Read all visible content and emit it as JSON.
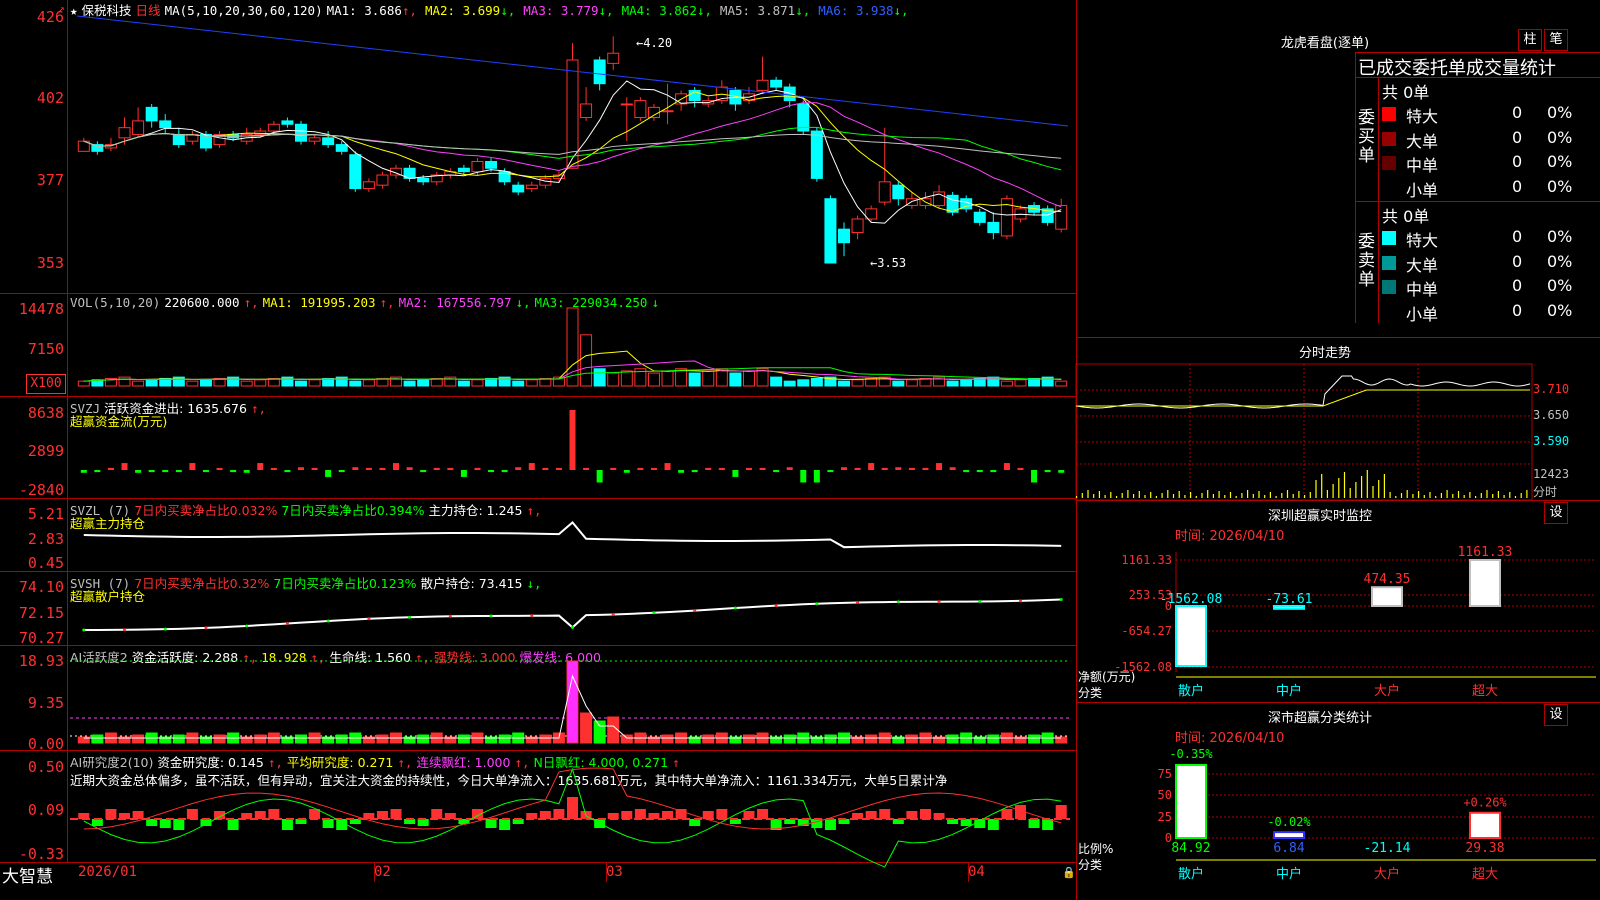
{
  "main_chart": {
    "star": "★",
    "stock_name": "保税科技",
    "period": "日线",
    "ma_label": "MA(5,10,20,30,60,120)",
    "ma_values": [
      {
        "label": "MA1:",
        "value": "3.686",
        "arrow": "↑",
        "color": "#ffffff"
      },
      {
        "label": "MA2:",
        "value": "3.699",
        "arrow": "↓",
        "color": "#ffff00"
      },
      {
        "label": "MA3:",
        "value": "3.779",
        "arrow": "↓",
        "color": "#ff40ff"
      },
      {
        "label": "MA4:",
        "value": "3.862",
        "arrow": "↓",
        "color": "#00ff00"
      },
      {
        "label": "MA5:",
        "value": "3.871",
        "arrow": "↓",
        "color": "#c0c0c0"
      },
      {
        "label": "MA6:",
        "value": "3.938",
        "arrow": "↓",
        "color": "#3060ff"
      }
    ],
    "y_ticks": [
      "426",
      "402",
      "377",
      "353"
    ],
    "high_label": "4.20",
    "low_label": "3.53"
  },
  "vol_panel": {
    "title": "VOL(5,10,20)",
    "value": "220600.000",
    "ma1": "MA1: 191995.203",
    "ma2": "MA2: 167556.797",
    "ma3": "MA3: 229034.250",
    "y_ticks": [
      "14478",
      "7150",
      "X100"
    ]
  },
  "svzj_panel": {
    "title": "SVZJ",
    "line1": "活跃资金进出: 1635.676",
    "line2": "超赢资金流(万元)",
    "y_ticks": [
      "8638",
      "2899",
      "-2840"
    ]
  },
  "svzl_panel": {
    "title": "SVZL (7)",
    "a": "7日内买卖净占比0.032%",
    "b": "7日内买卖净占比0.394%",
    "c": "主力持仓: 1.245",
    "line2": "超赢主力持仓",
    "y_ticks": [
      "5.21",
      "2.83",
      "0.45"
    ]
  },
  "svsh_panel": {
    "title": "SVSH (7)",
    "a": "7日内买卖净占比0.32%",
    "b": "7日内买卖净占比0.123%",
    "c": "散户持仓: 73.415",
    "line2": "超赢散户持仓",
    "y_ticks": [
      "74.10",
      "72.15",
      "70.27"
    ]
  },
  "ai_active_panel": {
    "title": "AI活跃度2",
    "a": "资金活跃度: 2.288",
    "b": "18.928",
    "c": "生命线: 1.560",
    "d": "强势线: 3.000",
    "e": "爆发线: 6.000",
    "y_ticks": [
      "18.93",
      "9.35",
      "0.00"
    ]
  },
  "ai_research_panel": {
    "title": "AI研究度2(10)",
    "a": "资金研究度: 0.145",
    "b": "平均研究度: 0.271",
    "c": "连续飘红: 1.000",
    "d": "N日飘红: 4.000, 0.271",
    "comment": "近期大资金总体偏多，虽不活跃，但有异动，宜关注大资金的持续性，今日大单净流入：1635.681万元，其中特大单净流入：1161.334万元，大单5日累计净",
    "y_ticks": [
      "0.50",
      "0.09",
      "-0.33"
    ]
  },
  "x_axis": {
    "labels": [
      "2026/01",
      "02",
      "03",
      "04"
    ],
    "brand": "大智慧"
  },
  "longhu": {
    "title": "龙虎看盘(逐单)",
    "btn_zhu": "柱",
    "btn_bi": "笔",
    "header": "已成交委托单成交量统计",
    "buy_label": "委买单",
    "sell_label": "委卖单",
    "buy_total": "共 0单",
    "sell_total": "共 0单",
    "buy_rows": [
      {
        "name": "特大",
        "count": "0",
        "pct": "0%",
        "color": "#ff0000"
      },
      {
        "name": "大单",
        "count": "0",
        "pct": "0%",
        "color": "#990000"
      },
      {
        "name": "中单",
        "count": "0",
        "pct": "0%",
        "color": "#660000"
      },
      {
        "name": "小单",
        "count": "0",
        "pct": "0%",
        "color": ""
      }
    ],
    "sell_rows": [
      {
        "name": "特大",
        "count": "0",
        "pct": "0%",
        "color": "#00ffff"
      },
      {
        "name": "大单",
        "count": "0",
        "pct": "0%",
        "color": "#009999"
      },
      {
        "name": "中单",
        "count": "0",
        "pct": "0%",
        "color": "#007777"
      },
      {
        "name": "小单",
        "count": "0",
        "pct": "0%",
        "color": ""
      }
    ]
  },
  "fenshi": {
    "title": "分时走势",
    "y_ticks": [
      "3.710",
      "3.650",
      "3.590"
    ],
    "vol_label": "12423",
    "vol_unit": "分时"
  },
  "sz_monitor": {
    "title": "深圳超赢实时监控",
    "btn": "设",
    "time": "时间: 2026/04/10",
    "y_ticks": [
      "1161.33",
      "253.53",
      "0",
      "-654.27",
      "-1562.08"
    ],
    "unit1": "净额(万元)",
    "unit2": "分类",
    "bars": [
      {
        "name": "散户",
        "value": -1562.08,
        "label": "-1562.08"
      },
      {
        "name": "中户",
        "value": -73.61,
        "label": "-73.61"
      },
      {
        "name": "大户",
        "value": 474.35,
        "label": "474.35"
      },
      {
        "name": "超大",
        "value": 1161.33,
        "label": "1161.33"
      }
    ]
  },
  "sz_class": {
    "title": "深市超赢分类统计",
    "btn": "设",
    "time": "时间: 2026/04/10",
    "y_ticks": [
      "75",
      "50",
      "25",
      "0"
    ],
    "unit1": "比例%",
    "unit2": "分类",
    "bars": [
      {
        "name": "散户",
        "value": 84.92,
        "label": "84.92",
        "delta": "-0.35%"
      },
      {
        "name": "中户",
        "value": 6.84,
        "label": "6.84",
        "delta": "-0.02%"
      },
      {
        "name": "大户",
        "value": -21.14,
        "label": "-21.14",
        "delta": ""
      },
      {
        "name": "超大",
        "value": 29.38,
        "label": "29.38",
        "delta": "+0.26%"
      }
    ]
  }
}
